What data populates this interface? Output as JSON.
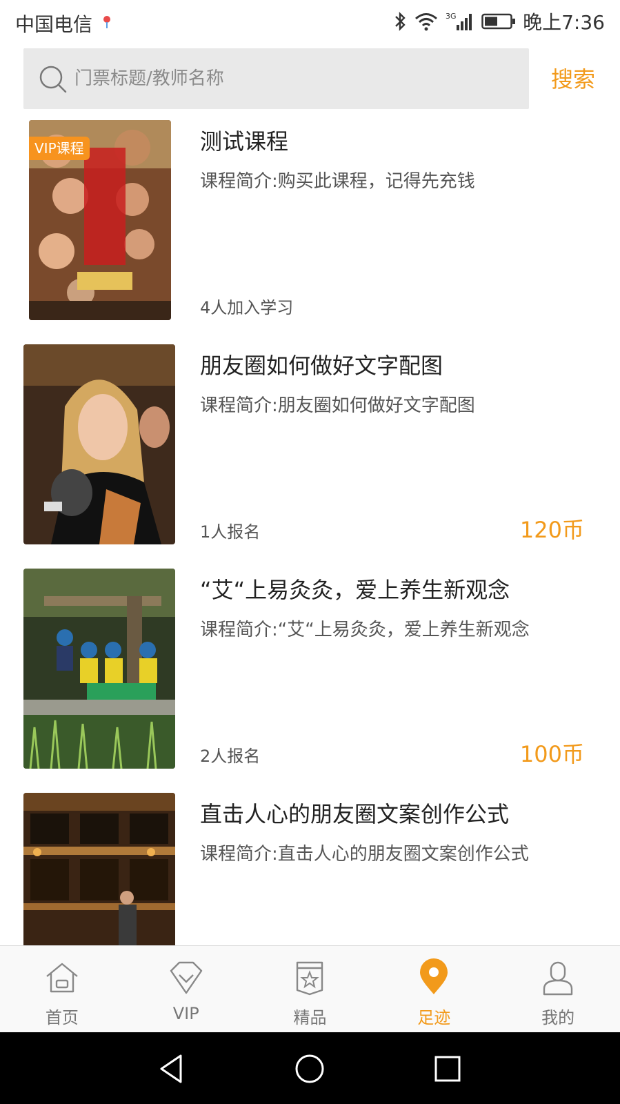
{
  "status_bar": {
    "carrier": "中国电信",
    "time": "晚上7:36",
    "network": "3G"
  },
  "search": {
    "placeholder": "门票标题/教师名称",
    "button_label": "搜索"
  },
  "courses": [
    {
      "title": "测试课程",
      "description": "课程简介:购买此课程，记得先充钱",
      "count": "4人加入学习",
      "price": "",
      "badge": "VIP课程"
    },
    {
      "title": "朋友圈如何做好文字配图",
      "description": "课程简介:朋友圈如何做好文字配图",
      "count": "1人报名",
      "price": "120币",
      "badge": ""
    },
    {
      "title": "“艾“上易灸灸，爱上养生新观念",
      "description": "课程简介:“艾“上易灸灸，爱上养生新观念",
      "count": "2人报名",
      "price": "100币",
      "badge": ""
    },
    {
      "title": "直击人心的朋友圈文案创作公式",
      "description": "课程简介:直击人心的朋友圈文案创作公式",
      "count": "",
      "price": "",
      "badge": ""
    }
  ],
  "tabs": [
    {
      "label": "首页",
      "icon": "home-icon"
    },
    {
      "label": "VIP",
      "icon": "diamond-icon"
    },
    {
      "label": "精品",
      "icon": "star-badge-icon"
    },
    {
      "label": "足迹",
      "icon": "location-pin-icon"
    },
    {
      "label": "我的",
      "icon": "person-icon"
    }
  ],
  "active_tab": "足迹",
  "colors": {
    "accent": "#f29a1b",
    "vip_badge": "#f7931e"
  }
}
